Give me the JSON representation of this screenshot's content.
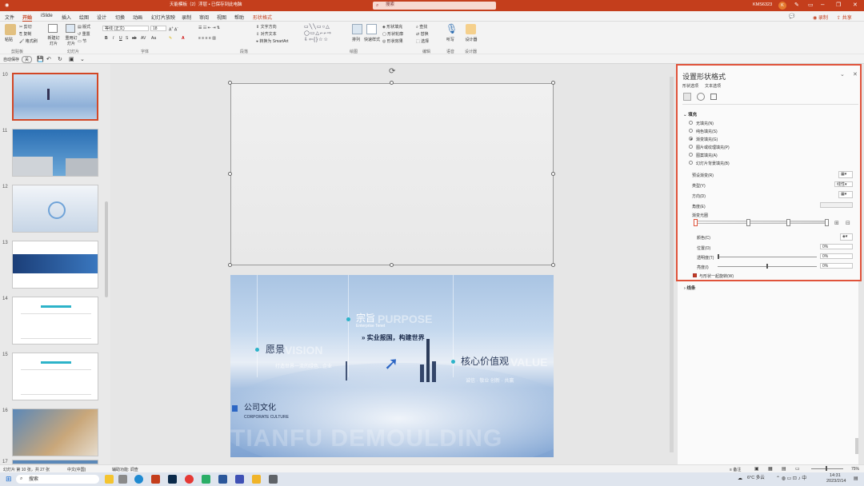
{
  "titlebar": {
    "doc_title": "天能模板（2）浮层 • 已保存到此电脑",
    "search_placeholder": "搜索",
    "user_name": "KMS6323",
    "user_initial": "K"
  },
  "menu": {
    "items": [
      "文件",
      "开始",
      "iSlide",
      "插入",
      "绘图",
      "设计",
      "切换",
      "动画",
      "幻灯片放映",
      "录制",
      "审阅",
      "视图",
      "帮助",
      "形状格式"
    ],
    "active_index": 1,
    "record_label": "录制",
    "share_label": "共享"
  },
  "ribbon": {
    "paste": "粘贴",
    "cut": "剪切",
    "copy": "复制",
    "format_painter": "格式刷",
    "new_slide": "新建幻灯片",
    "reuse_slide": "重用幻灯片",
    "layout": "版式",
    "reset": "重置",
    "section": "节",
    "font_name": "等线 (正文)",
    "font_size": "18",
    "text_direction": "文字方向",
    "align_text": "对齐文本",
    "convert_smartart": "转换为 SmartArt",
    "arrange": "排列",
    "quick_styles": "快速样式",
    "shape_fill": "形状填充",
    "shape_outline": "形状轮廓",
    "shape_effects": "形状效果",
    "find": "查找",
    "replace": "替换",
    "select": "选择",
    "dictate": "听写",
    "designer": "设计器",
    "groups": [
      "剪贴板",
      "幻灯片",
      "字体",
      "段落",
      "绘图",
      "编辑",
      "语音",
      "设计器"
    ]
  },
  "qat": {
    "autosave": "自动保存",
    "autosave_state": "关"
  },
  "thumbnails": [
    {
      "num": "10",
      "selected": true
    },
    {
      "num": "11",
      "selected": false
    },
    {
      "num": "12",
      "selected": false
    },
    {
      "num": "13",
      "selected": false
    },
    {
      "num": "14",
      "selected": false
    },
    {
      "num": "15",
      "selected": false
    },
    {
      "num": "16",
      "selected": false
    },
    {
      "num": "17",
      "selected": false
    }
  ],
  "slide": {
    "purpose_cn": "宗旨",
    "purpose_en": "PURPOSE",
    "purpose_sub": "Enterprise Tenet",
    "purpose_text": "实业报国，构建世界",
    "vision_cn": "愿景",
    "vision_en": "VISION",
    "vision_text": "打造世界一流的绿色...企业",
    "value_cn": "核心价值观",
    "value_en": "VALUE",
    "value_text": "诚信 · 敬业 创新 · 共赢",
    "culture_cn": "公司文化",
    "culture_en": "CORPORATE CULTURE",
    "watermark": "TIANFU DEMOULDING"
  },
  "pane": {
    "title": "设置形状格式",
    "tab_shape": "形状选项",
    "tab_text": "文本选项",
    "fill_header": "填充",
    "fill_options": [
      "无填充(N)",
      "纯色填充(S)",
      "渐变填充(G)",
      "图片或纹理填充(P)",
      "图案填充(A)",
      "幻灯片背景填充(B)"
    ],
    "fill_selected": 2,
    "preset_gradient": "预设渐变(R)",
    "type": "类型(Y)",
    "type_value": "线性",
    "direction": "方向(D)",
    "angle": "角度(E)",
    "gradient_stops": "渐变光圈",
    "color": "颜色(C)",
    "position": "位置(O)",
    "position_value": "0%",
    "transparency": "透明度(T)",
    "transparency_value": "0%",
    "brightness": "亮度(I)",
    "brightness_value": "0%",
    "rotate_with_shape": "与形状一起旋转(W)",
    "line_header": "线条"
  },
  "statusbar": {
    "slide_info": "幻灯片 第 10 张，共 27 张",
    "language": "中文(中国)",
    "accessibility": "辅助功能: 调查",
    "notes": "备注",
    "zoom": "75%"
  },
  "taskbar": {
    "search": "搜索",
    "weather": "6°C 多云",
    "time": "14:31",
    "date": "2023/2/14"
  },
  "colors": {
    "accent": "#c43e1c",
    "highlight_border": "#e0533b",
    "slide_teal": "#2db3c9"
  }
}
